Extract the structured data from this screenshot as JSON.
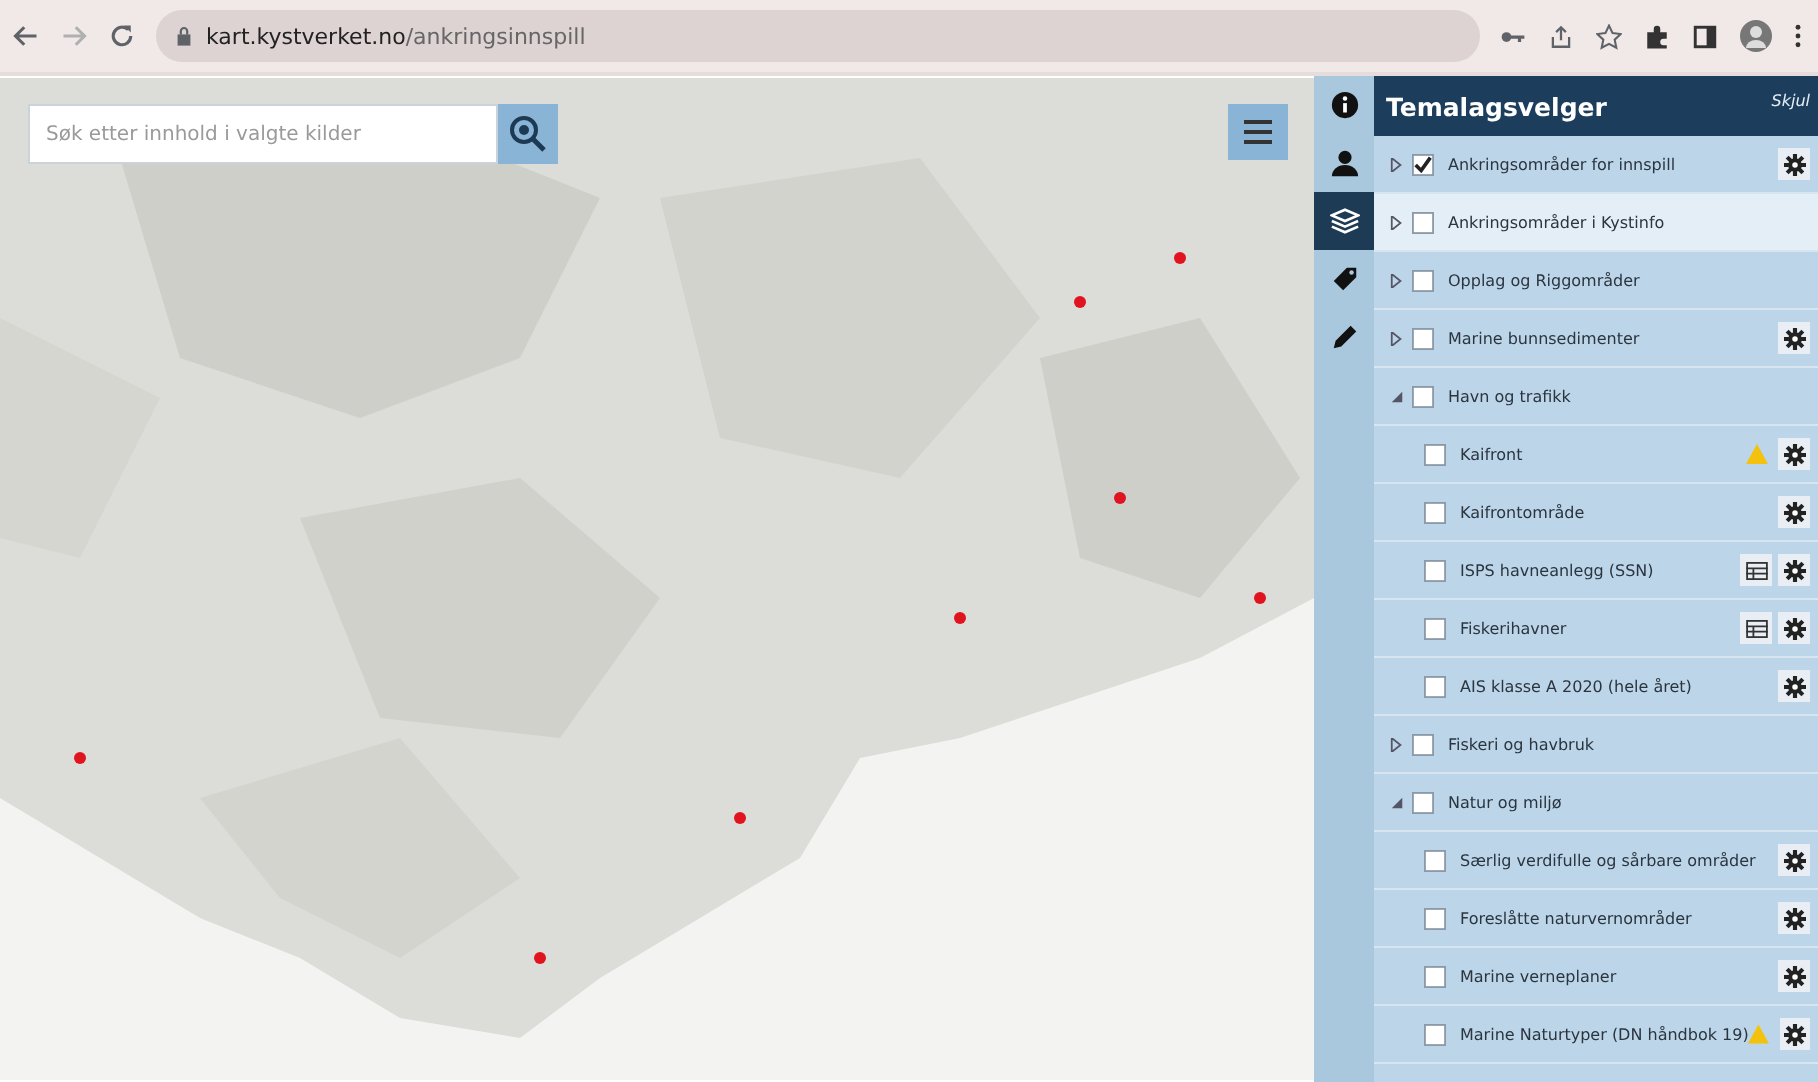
{
  "browser": {
    "url_domain": "kart.kystverket.no",
    "url_path": "/ankringsinnspill"
  },
  "map": {
    "kind": "picture",
    "search": {
      "placeholder": "Søk etter innhold i valgte kilder"
    }
  },
  "rail": [
    {
      "selected": false
    },
    {
      "selected": false
    },
    {
      "selected": true
    },
    {
      "selected": false
    },
    {
      "selected": false
    }
  ],
  "panel": {
    "title": "Temalagsvelger",
    "hide_label": "Skjul",
    "layers": [
      {
        "label": "Ankringsområder for innspill",
        "kind": "group",
        "expanded": false,
        "checked": true,
        "highlighted": false,
        "gear": true,
        "table": false,
        "warning": false
      },
      {
        "label": "Ankringsområder i Kystinfo",
        "kind": "group",
        "expanded": false,
        "checked": false,
        "highlighted": true,
        "gear": false,
        "table": false,
        "warning": false
      },
      {
        "label": "Opplag og Riggområder",
        "kind": "group",
        "expanded": false,
        "checked": false,
        "highlighted": false,
        "gear": false,
        "table": false,
        "warning": false
      },
      {
        "label": "Marine bunnsedimenter",
        "kind": "group",
        "expanded": false,
        "checked": false,
        "highlighted": false,
        "gear": true,
        "table": false,
        "warning": false
      },
      {
        "label": "Havn og trafikk",
        "kind": "group",
        "expanded": true,
        "checked": false,
        "highlighted": false,
        "gear": false,
        "table": false,
        "warning": false
      },
      {
        "label": "Kaifront",
        "kind": "child",
        "checked": false,
        "highlighted": false,
        "gear": true,
        "table": false,
        "warning": true
      },
      {
        "label": "Kaifrontområde",
        "kind": "child",
        "checked": false,
        "highlighted": false,
        "gear": true,
        "table": false,
        "warning": false
      },
      {
        "label": "ISPS havneanlegg (SSN)",
        "kind": "child",
        "checked": false,
        "highlighted": false,
        "gear": true,
        "table": true,
        "warning": false
      },
      {
        "label": "Fiskerihavner",
        "kind": "child",
        "checked": false,
        "highlighted": false,
        "gear": true,
        "table": true,
        "warning": false
      },
      {
        "label": "AIS klasse A 2020 (hele året)",
        "kind": "child",
        "checked": false,
        "highlighted": false,
        "gear": true,
        "table": false,
        "warning": false
      },
      {
        "label": "Fiskeri og havbruk",
        "kind": "group",
        "expanded": false,
        "checked": false,
        "highlighted": false,
        "gear": false,
        "table": false,
        "warning": false
      },
      {
        "label": "Natur og miljø",
        "kind": "group",
        "expanded": true,
        "checked": false,
        "highlighted": false,
        "gear": false,
        "table": false,
        "warning": false
      },
      {
        "label": "Særlig verdifulle og sårbare områder",
        "kind": "child",
        "checked": false,
        "highlighted": false,
        "gear": true,
        "table": false,
        "warning": false
      },
      {
        "label": "Foreslåtte naturvernområder",
        "kind": "child",
        "checked": false,
        "highlighted": false,
        "gear": true,
        "table": false,
        "warning": false
      },
      {
        "label": "Marine verneplaner",
        "kind": "child",
        "checked": false,
        "highlighted": false,
        "gear": true,
        "table": false,
        "warning": false
      },
      {
        "label": "Marine Naturtyper (DN håndbok 19)",
        "kind": "child",
        "checked": false,
        "highlighted": false,
        "gear": true,
        "table": false,
        "warning": true
      }
    ]
  }
}
